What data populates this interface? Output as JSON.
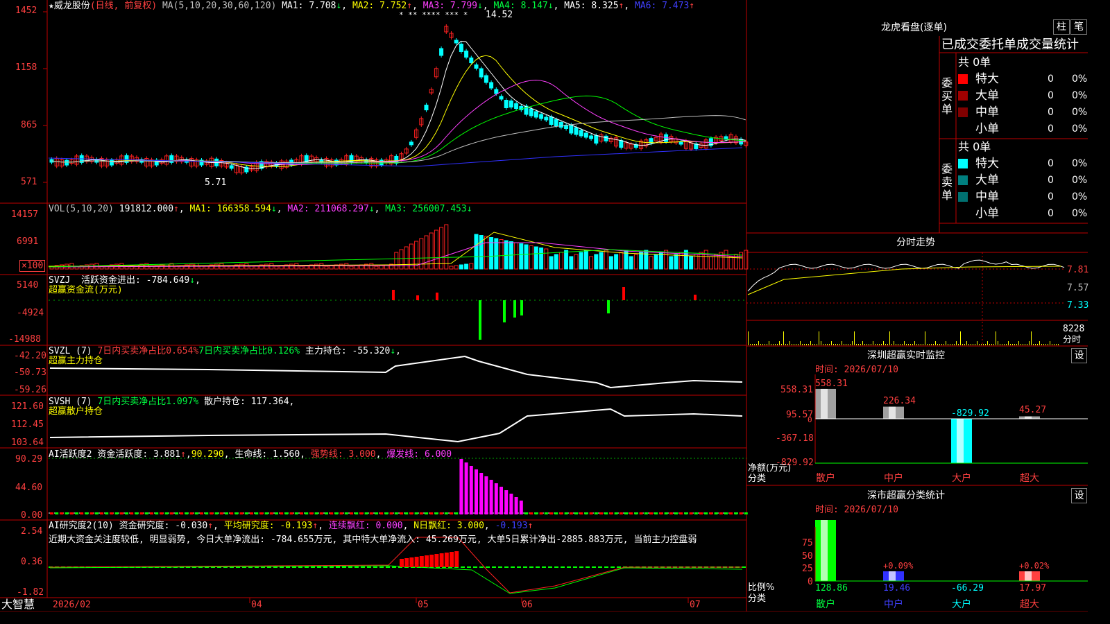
{
  "stock": {
    "name": "威龙股份",
    "period": "(日线, 前复权)",
    "star": "★"
  },
  "ma_line": {
    "label": "MA(5,10,20,30,60,120)",
    "ma1": "MA1: 7.708",
    "ma2": "MA2: 7.752",
    "ma3": "MA3: 7.799",
    "ma4": "MA4: 8.147",
    "ma5": "MA5: 8.325",
    "ma6": "MA6: 7.473"
  },
  "price_axis": [
    "1452",
    "1158",
    "865",
    "571"
  ],
  "price_marks": {
    "high": "14.52",
    "low": "5.71",
    "stars": "* ** **** *** *"
  },
  "vol": {
    "label": "VOL(5,10,20)",
    "value": "191812.000",
    "ma1": "MA1: 166358.594",
    "ma2": "MA2: 211068.297",
    "ma3": "MA3: 256007.453",
    "axis": [
      "14157",
      "6991",
      "×100"
    ]
  },
  "svzj": {
    "label": "SVZJ",
    "desc": "活跃资金进出: -784.649",
    "sub": "超赢资金流(万元)",
    "axis": [
      "5140",
      "-4924",
      "-14988"
    ]
  },
  "svzl": {
    "label": "SVZL (7)",
    "buy7": "7日内买卖净占比0.654%",
    "buy7b": "7日内买卖净占比0.126%",
    "main": "主力持仓: -55.320",
    "sub": "超赢主力持仓",
    "axis": [
      "-42.20",
      "-50.73",
      "-59.26"
    ]
  },
  "svsh": {
    "label": "SVSH (7)",
    "buy7": "7日内买卖净占比1.097%",
    "retail": "散户持仓: 117.364",
    "sub": "超赢散户持仓",
    "axis": [
      "121.60",
      "112.45",
      "103.64"
    ]
  },
  "ai_act": {
    "label": "AI活跃度2",
    "desc": "资金活跃度: 3.881",
    "val": "90.290",
    "life": "生命线: 1.560",
    "strong": "强势线: 3.000",
    "burst": "爆发线: 6.000",
    "axis": [
      "90.29",
      "44.60",
      "0.00"
    ]
  },
  "ai_res": {
    "label": "AI研究度2(10)",
    "desc": "资金研究度: -0.030",
    "avg": "平均研究度: -0.193",
    "cont": "连续飘红: 0.000",
    "nday": "N日飘红: 3.000",
    "neg": "-0.193",
    "note": "近期大资金关注度较低, 明显弱势, 今日大单净流出: -784.655万元, 其中特大单净流入: 45.269万元, 大单5日累计净出-2885.883万元, 当前主力控盘弱",
    "axis": [
      "2.54",
      "0.36",
      "-1.82"
    ]
  },
  "x_axis": {
    "brand": "大智慧",
    "labels": [
      "2026/02",
      "04",
      "05",
      "06",
      "07"
    ]
  },
  "lhb": {
    "title": "龙虎看盘(逐单)",
    "btn1": "柱",
    "btn2": "笔",
    "header": "已成交委托单成交量统计",
    "buy": {
      "title": "委买单",
      "total": "共 0单",
      "rows": [
        {
          "name": "特大",
          "n": "0",
          "p": "0%",
          "color": "#ff0000"
        },
        {
          "name": "大单",
          "n": "0",
          "p": "0%",
          "color": "#a00000"
        },
        {
          "name": "中单",
          "n": "0",
          "p": "0%",
          "color": "#800000"
        },
        {
          "name": "小单",
          "n": "0",
          "p": "0%",
          "color": "#000000"
        }
      ]
    },
    "sell": {
      "title": "委卖单",
      "total": "共 0单",
      "rows": [
        {
          "name": "特大",
          "n": "0",
          "p": "0%",
          "color": "#00ffff"
        },
        {
          "name": "大单",
          "n": "0",
          "p": "0%",
          "color": "#008080"
        },
        {
          "name": "中单",
          "n": "0",
          "p": "0%",
          "color": "#007070"
        },
        {
          "name": "小单",
          "n": "0",
          "p": "0%",
          "color": "#000000"
        }
      ]
    }
  },
  "intraday": {
    "title": "分时走势",
    "axis": [
      "7.81",
      "7.57",
      "7.33"
    ],
    "vol": "8228",
    "unit": "分时"
  },
  "monitor": {
    "title": "深圳超赢实时监控",
    "btn": "设",
    "time": "时间: 2026/07/10",
    "axis": [
      "558.31",
      "95.57",
      "-367.18",
      "-829.92"
    ],
    "zero": "0",
    "bars": [
      {
        "label": "散户",
        "value": "558.31"
      },
      {
        "label": "中户",
        "value": "226.34"
      },
      {
        "label": "大户",
        "value": "-829.92"
      },
      {
        "label": "超大",
        "value": "45.27"
      }
    ],
    "ylabel": "净额(万元)",
    "xlabel": "分类"
  },
  "classify": {
    "title": "深市超赢分类统计",
    "btn": "设",
    "time": "时间: 2026/07/10",
    "axis": [
      "75",
      "50",
      "25",
      "0"
    ],
    "pct_mid": "+0.09%",
    "pct_big": "+0.02%",
    "bars": [
      {
        "label": "散户",
        "value": "128.86"
      },
      {
        "label": "中户",
        "value": "19.46"
      },
      {
        "label": "大户",
        "value": "-66.29"
      },
      {
        "label": "超大",
        "value": "17.97"
      }
    ],
    "ylabel": "比例%",
    "xlabel": "分类"
  }
}
